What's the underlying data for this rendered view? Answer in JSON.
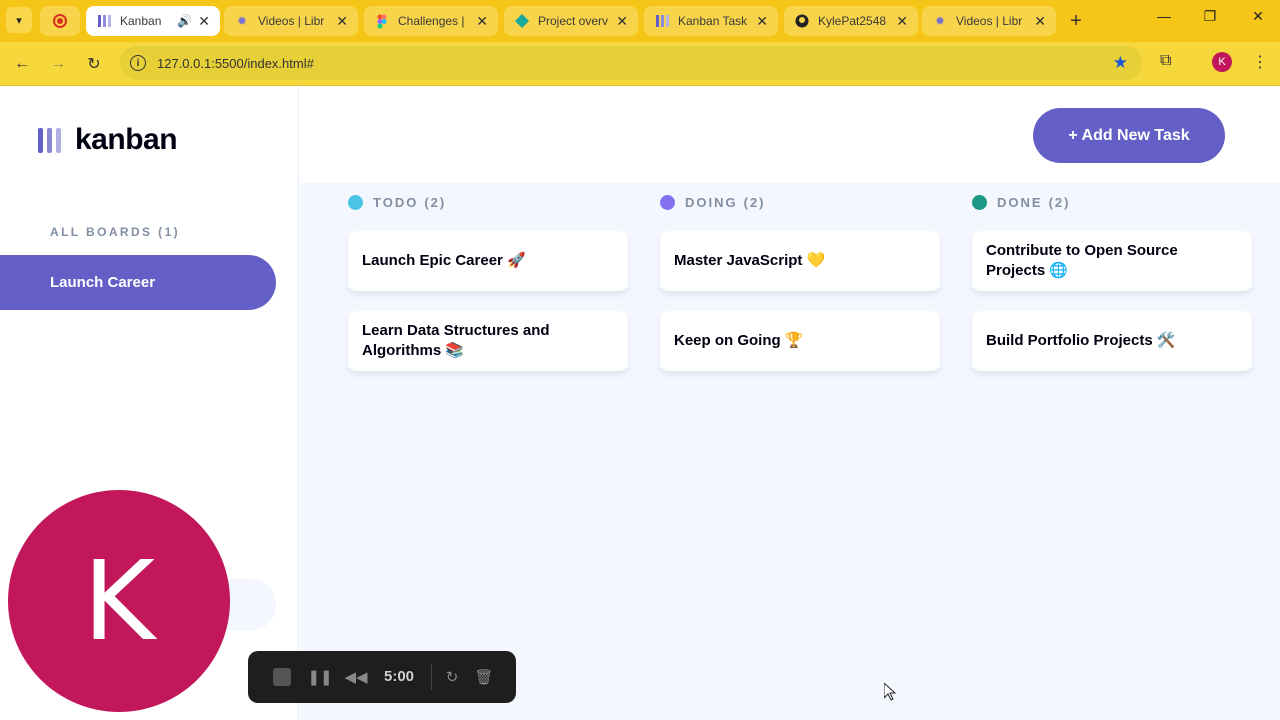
{
  "browser": {
    "tabs": [
      {
        "title": "Kanban",
        "icon": "kanban-favicon",
        "active": true,
        "audio": true
      },
      {
        "title": "Videos | Libr",
        "icon": "gear-favicon"
      },
      {
        "title": "Challenges |",
        "icon": "figma-favicon"
      },
      {
        "title": "Project overv",
        "icon": "diamond-favicon"
      },
      {
        "title": "Kanban Task",
        "icon": "kanban-favicon"
      },
      {
        "title": "KylePat2548",
        "icon": "github-favicon"
      },
      {
        "title": "Videos | Libr",
        "icon": "gear-favicon"
      }
    ],
    "url": "127.0.0.1:5500/index.html#",
    "profile_initial": "K"
  },
  "sidebar": {
    "logo_text": "kanban",
    "boards_heading": "ALL BOARDS (1)",
    "boards": [
      {
        "label": "Launch Career",
        "active": true
      }
    ]
  },
  "header": {
    "add_task_label": "+ Add New Task"
  },
  "columns": [
    {
      "name": "TODO",
      "count": "(2)",
      "color": "#49c4e5",
      "cards": [
        "Launch Epic Career 🚀",
        "Learn Data Structures and Algorithms 📚"
      ]
    },
    {
      "name": "DOING",
      "count": "(2)",
      "color": "#8471f2",
      "cards": [
        "Master JavaScript 💛",
        "Keep on Going 🏆"
      ]
    },
    {
      "name": "DONE",
      "count": "(2)",
      "color": "#1d9a87",
      "cards": [
        "Contribute to Open Source Projects 🌐",
        "Build Portfolio Projects 🛠️"
      ]
    }
  ],
  "recorder": {
    "avatar_initial": "K",
    "time": "5:00"
  },
  "colors": {
    "accent": "#635fc7",
    "browser_frame": "#f5c518",
    "avatar": "#c2185b"
  }
}
